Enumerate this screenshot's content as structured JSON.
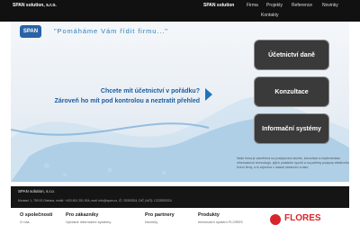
{
  "header": {
    "brand": "SPAN solution, s.r.o.",
    "nav": [
      "SPAN solution",
      "Firma",
      "Projekty",
      "Reference",
      "Novinky",
      "Kontakty"
    ]
  },
  "hero": {
    "logo_text": "SPAN",
    "slogan": "\"Pomáháme Vám řídit firmu...\"",
    "headline_line1": "Chcete mít účetnictví v pořádku?",
    "headline_line2": "Zároveň ho mít pod kontrolou a neztratit přehled",
    "tiles": [
      "Účetnictví daně",
      "Konzultace",
      "Informační systémy"
    ],
    "intro": "Naše firma je zaměřena na poskytování služeb, konzultací a implementací informačních technologií, jejich praktické využití a na potřeby podpory efektivního řízení firmy, a to zejména v oblasti účetnictví a daní."
  },
  "footer": {
    "name": "SPAN solution, s.r.o.",
    "contact": "Moravní 1, 750 00 Ostrava, mobil: +420 601 251 004, mail: info@span.cz, IČ: 25393324, DIČ (VAT): CZ25393324"
  },
  "columns": [
    {
      "title": "O společnosti",
      "item": "O nás"
    },
    {
      "title": "Pro zákazníky",
      "item": "Vybrané informační systémy"
    },
    {
      "title": "Pro partnery",
      "item": "Novinky"
    },
    {
      "title": "Produkty",
      "item": "Informační systém FLORES"
    }
  ],
  "partner": {
    "name": "FLORES"
  },
  "colors": {
    "accent": "#1c5da0",
    "tile": "#3a3a3a",
    "flores": "#d7262b"
  }
}
